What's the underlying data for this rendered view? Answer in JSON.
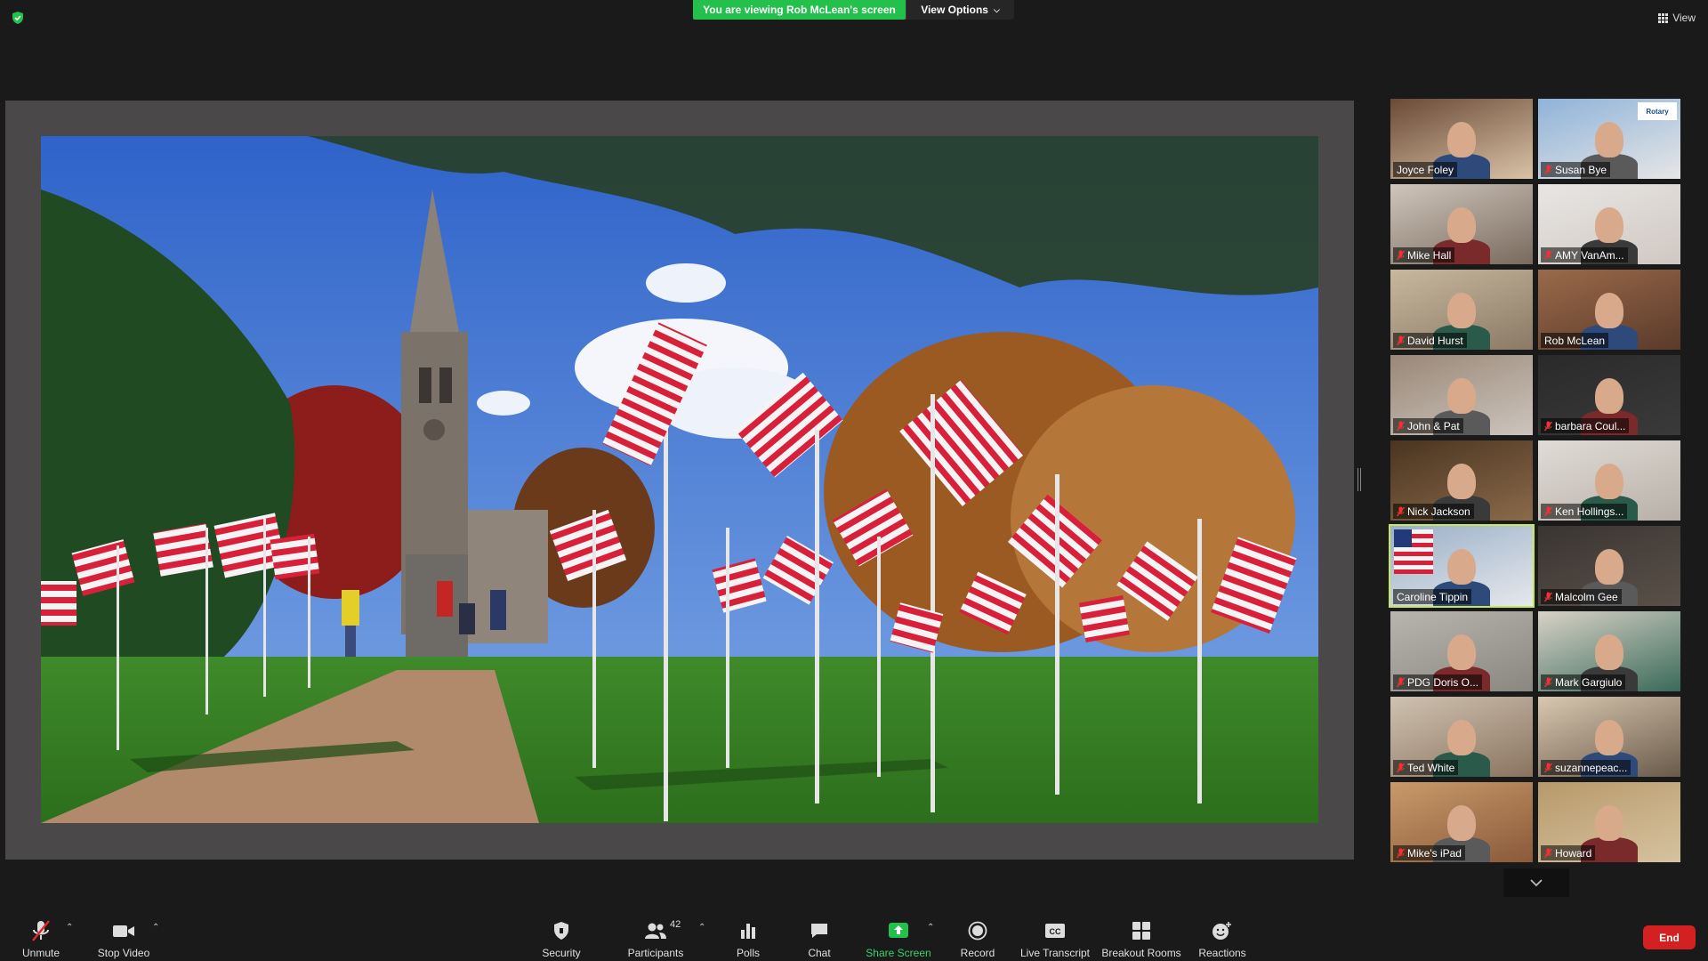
{
  "header": {
    "banner_text": "You are viewing Rob McLean's screen",
    "view_options_label": "View Options",
    "view_label": "View",
    "colors": {
      "banner": "#23c04b",
      "active_speaker": "#c6e85a",
      "end": "#d32121"
    }
  },
  "participants": [
    {
      "name": "Joyce Foley",
      "muted": false
    },
    {
      "name": "Susan Bye",
      "muted": true
    },
    {
      "name": "Mike Hall",
      "muted": true
    },
    {
      "name": "AMY VanAm...",
      "muted": true
    },
    {
      "name": "David Hurst",
      "muted": true
    },
    {
      "name": "Rob McLean",
      "muted": false
    },
    {
      "name": "John & Pat",
      "muted": true
    },
    {
      "name": "barbara Coul...",
      "muted": true
    },
    {
      "name": "Nick Jackson",
      "muted": true
    },
    {
      "name": "Ken Hollings...",
      "muted": true
    },
    {
      "name": "Caroline Tippin",
      "muted": false,
      "active": true
    },
    {
      "name": "Malcolm Gee",
      "muted": true
    },
    {
      "name": "PDG Doris O...",
      "muted": true
    },
    {
      "name": "Mark Gargiulo",
      "muted": true
    },
    {
      "name": "Ted White",
      "muted": true
    },
    {
      "name": "suzannepeac...",
      "muted": true
    },
    {
      "name": "Mike's iPad",
      "muted": true
    },
    {
      "name": "Howard",
      "muted": true
    }
  ],
  "tile_labels": {
    "susan_tile_banner": "Rotary"
  },
  "toolbar": {
    "unmute": "Unmute",
    "stop_video": "Stop Video",
    "security": "Security",
    "participants": "Participants",
    "participants_count": "42",
    "polls": "Polls",
    "chat": "Chat",
    "share_screen": "Share Screen",
    "record": "Record",
    "live_transcript": "Live Transcript",
    "breakout_rooms": "Breakout Rooms",
    "reactions": "Reactions",
    "end": "End",
    "cc_glyph": "CC"
  },
  "icons": [
    "shield-check-icon",
    "grid-view-icon",
    "mic-muted-icon",
    "video-camera-icon",
    "shield-icon",
    "participants-icon",
    "polls-icon",
    "chat-icon",
    "share-screen-icon",
    "record-icon",
    "cc-icon",
    "breakout-rooms-icon",
    "reactions-icon",
    "chevron-down-icon"
  ]
}
